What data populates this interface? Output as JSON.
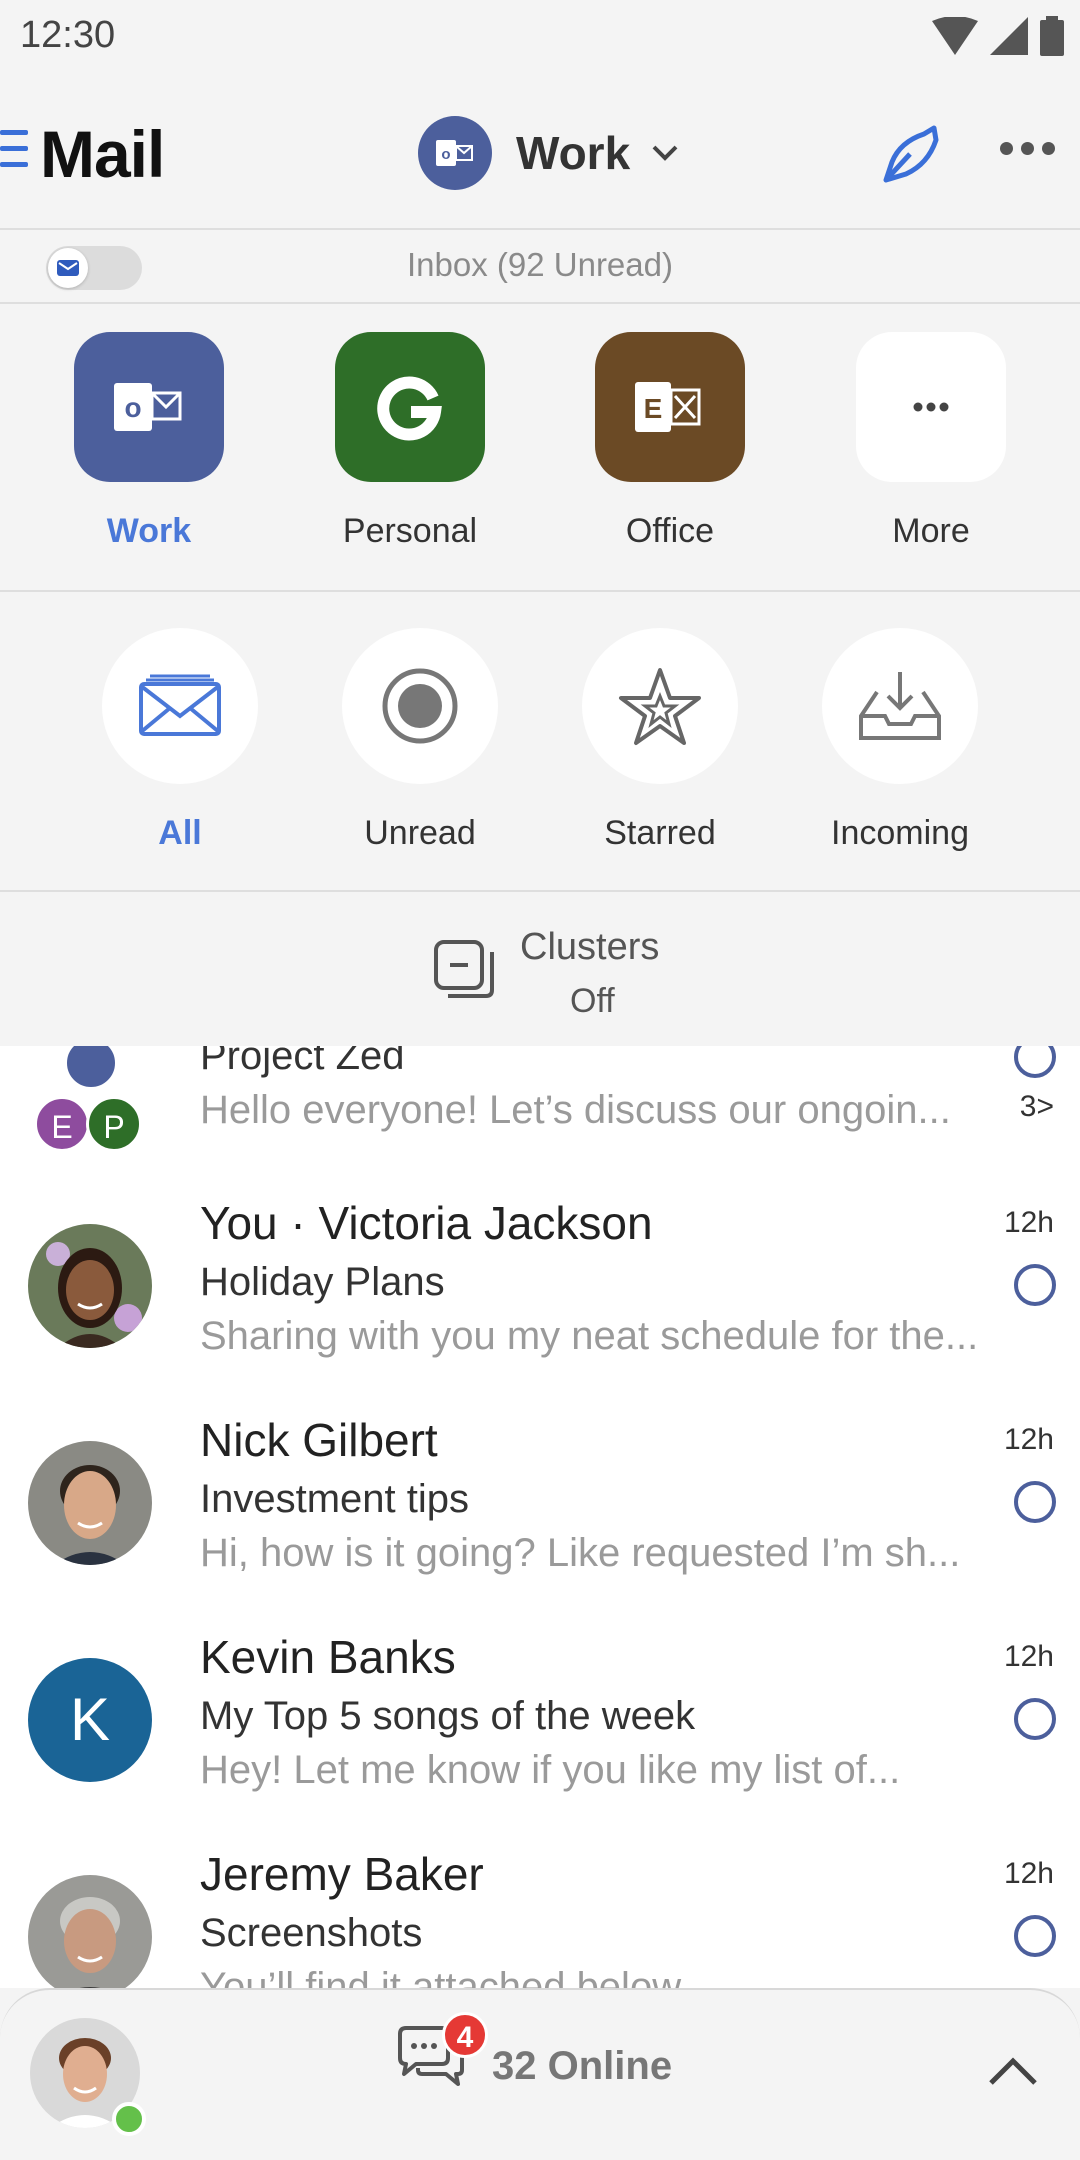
{
  "status": {
    "time": "12:30"
  },
  "header": {
    "title": "Mail",
    "account": "Work"
  },
  "inbox": {
    "label": "Inbox (92 Unread)"
  },
  "accounts": [
    {
      "label": "Work",
      "icon": "outlook-icon",
      "color": "#4c5f9c",
      "active": true
    },
    {
      "label": "Personal",
      "icon": "google-icon",
      "color": "#2e6e28",
      "active": false
    },
    {
      "label": "Office",
      "icon": "exchange-icon",
      "color": "#6b4a25",
      "active": false
    },
    {
      "label": "More",
      "icon": "more-icon",
      "color": "#ffffff",
      "active": false
    }
  ],
  "filters": [
    {
      "label": "All",
      "icon": "envelope-icon",
      "active": true
    },
    {
      "label": "Unread",
      "icon": "radio-dot-icon",
      "active": false
    },
    {
      "label": "Starred",
      "icon": "star-icon",
      "active": false
    },
    {
      "label": "Incoming",
      "icon": "inbox-download-icon",
      "active": false
    }
  ],
  "clusters": {
    "title": "Clusters",
    "status": "Off"
  },
  "mails": [
    {
      "sender": "",
      "subject": "Project Zed",
      "preview": "Hello everyone! Let’s discuss our ongoin...",
      "time": "",
      "count": "3>",
      "avatar": "group-avatars"
    },
    {
      "sender": "You · Victoria Jackson",
      "subject": "Holiday Plans",
      "preview": "Sharing with you my neat schedule for the...",
      "time": "12h",
      "avatar": "photo"
    },
    {
      "sender": "Nick Gilbert",
      "subject": "Investment tips",
      "preview": "Hi, how is it going? Like requested I’m sh...",
      "time": "12h",
      "avatar": "photo"
    },
    {
      "sender": "Kevin Banks",
      "subject": "My Top 5 songs of the week",
      "preview": "Hey! Let me know if you like my list of...",
      "time": "12h",
      "avatar": "letter",
      "initial": "K"
    },
    {
      "sender": "Jeremy Baker",
      "subject": "Screenshots",
      "preview": "You’ll find it attached below",
      "time": "12h",
      "avatar": "photo"
    }
  ],
  "group_avatars": [
    "E",
    "P"
  ],
  "bottom": {
    "badge": "4",
    "online": "32 Online"
  },
  "colors": {
    "accent": "#4a78d8",
    "brand": "#4c5f9c",
    "badge": "#e53935",
    "presence": "#64c04a"
  }
}
